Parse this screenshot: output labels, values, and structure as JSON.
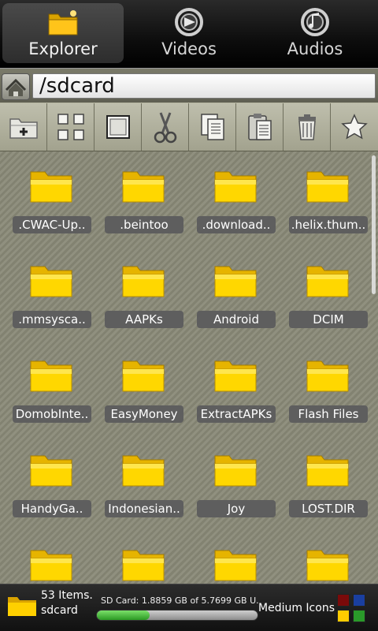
{
  "tabs": [
    {
      "label": "Explorer",
      "icon": "folder-icon",
      "active": true
    },
    {
      "label": "Videos",
      "icon": "video-icon",
      "active": false
    },
    {
      "label": "Audios",
      "icon": "music-icon",
      "active": false
    }
  ],
  "path": {
    "value": "/sdcard",
    "home_icon": "home-icon"
  },
  "toolbar": [
    {
      "name": "new-folder-button",
      "icon": "new-folder-icon"
    },
    {
      "name": "view-grid-button",
      "icon": "grid-icon"
    },
    {
      "name": "select-all-button",
      "icon": "select-icon"
    },
    {
      "name": "cut-button",
      "icon": "scissors-icon"
    },
    {
      "name": "copy-button",
      "icon": "copy-icon"
    },
    {
      "name": "paste-button",
      "icon": "paste-icon"
    },
    {
      "name": "delete-button",
      "icon": "trash-icon"
    },
    {
      "name": "favorite-button",
      "icon": "star-icon"
    }
  ],
  "files": [
    ".CWAC-Up..",
    ".beintoo",
    ".download..",
    ".helix.thum..",
    ".mmsysca..",
    "AAPKs",
    "Android",
    "DCIM",
    "DomobInte..",
    "EasyMoney",
    "ExtractAPKs",
    "Flash Files",
    "HandyGa..",
    "Indonesian..",
    "Joy",
    "LOST.DIR",
    "",
    "",
    "",
    ""
  ],
  "status": {
    "count": "53 Items.",
    "name": "sdcard",
    "storage": "SD Card: 1.8859 GB of 5.7699 GB U...",
    "used_fraction": 0.33,
    "size_mode": "Medium Icons"
  },
  "colors": {
    "folder": "#ffd700",
    "swatches": [
      "#7a0a0a",
      "#1a3fa0",
      "#ffcc00",
      "#2a9a2a"
    ]
  }
}
